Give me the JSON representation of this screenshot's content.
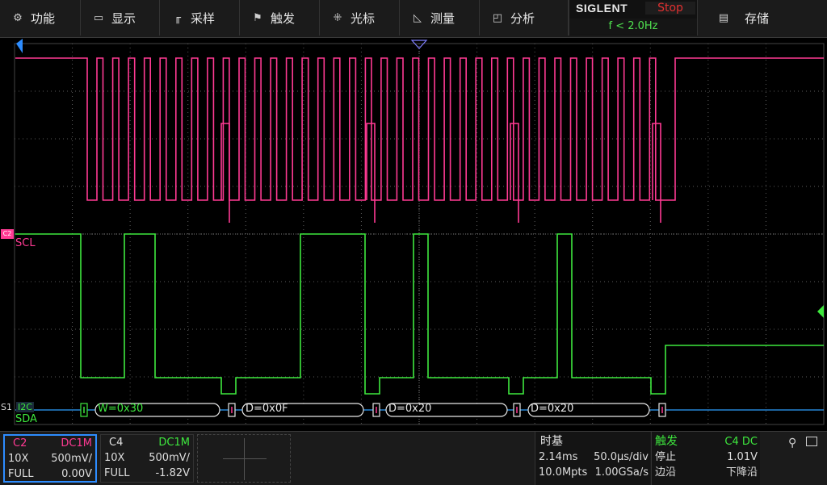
{
  "menu": {
    "items": [
      {
        "id": "function",
        "label": "功能",
        "icon": "gear-icon",
        "glyph": "⚙"
      },
      {
        "id": "display",
        "label": "显示",
        "icon": "monitor-icon",
        "glyph": "▭"
      },
      {
        "id": "acquire",
        "label": "采样",
        "icon": "sample-icon",
        "glyph": "╓"
      },
      {
        "id": "trigger",
        "label": "触发",
        "icon": "trigger-flag-icon",
        "glyph": "⚑"
      },
      {
        "id": "cursor",
        "label": "光标",
        "icon": "cursor-icon",
        "glyph": "⁜"
      },
      {
        "id": "measure",
        "label": "测量",
        "icon": "measure-icon",
        "glyph": "◺"
      },
      {
        "id": "analyze",
        "label": "分析",
        "icon": "analyze-icon",
        "glyph": "◰"
      }
    ],
    "storage_label": "存储",
    "storage_icon": "storage-icon"
  },
  "brand": {
    "logo": "SIGLENT",
    "run_state": "Stop",
    "trigger_freq": "f < 2.0Hz"
  },
  "colors": {
    "ch2": "#ff3a93",
    "ch4": "#3ee83e",
    "bus": "#2da0ff",
    "grid": "#5a5a5a",
    "stop": "#e23030"
  },
  "channels": {
    "c2": {
      "name": "C2",
      "coupling": "DC1M",
      "probe": "10X",
      "scale": "500mV/",
      "bw": "FULL",
      "offset": "0.00V",
      "marker": "C2",
      "trace_label": "SCL"
    },
    "c4": {
      "name": "C4",
      "coupling": "DC1M",
      "probe": "10X",
      "scale": "500mV/",
      "bw": "FULL",
      "offset": "-1.82V",
      "trace_label": "SDA"
    }
  },
  "bus": {
    "marker": "S1",
    "protocol": "I2C",
    "source_label": "SDA",
    "frames": [
      {
        "label": "W=0x30"
      },
      {
        "label": "D=0x0F"
      },
      {
        "label": "D=0x20"
      },
      {
        "label": "D=0x20"
      }
    ]
  },
  "timebase": {
    "title": "时基",
    "delay": "2.14ms",
    "scale": "50.0µs/div",
    "memory": "10.0Mpts",
    "sample_rate": "1.00GSa/s"
  },
  "trigger": {
    "title": "触发",
    "source": "C4 DC",
    "level_label": "停止",
    "level": "1.01V",
    "edge_label": "边沿",
    "slope": "下降沿"
  },
  "status_icons": [
    "usb-icon",
    "network-icon"
  ]
}
